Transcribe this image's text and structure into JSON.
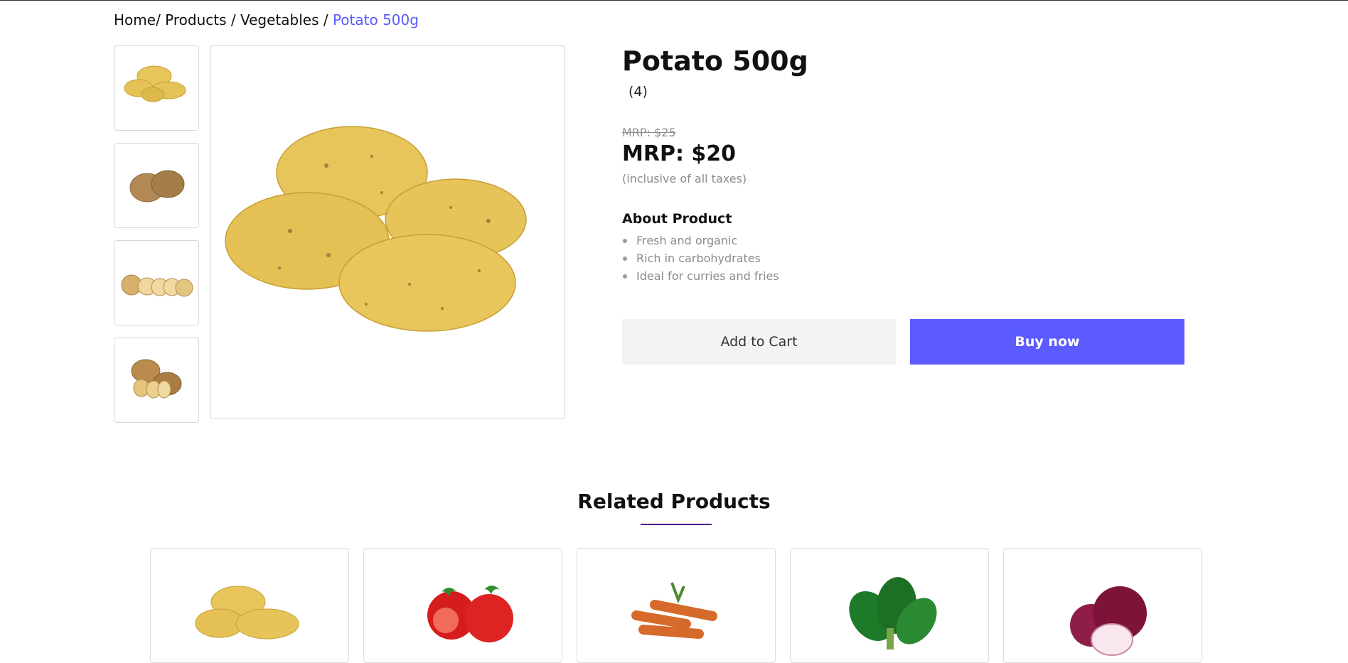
{
  "breadcrumb": {
    "home": "Home",
    "products": "Products",
    "vegetables": "Vegetables",
    "current": "Potato 500g"
  },
  "product": {
    "title": "Potato 500g",
    "rating": "(4)",
    "mrp_old": "MRP: $25",
    "mrp_new": "MRP: $20",
    "tax_note": "(inclusive of all taxes)",
    "about_title": "About Product",
    "about_points": [
      "Fresh and organic",
      "Rich in carbohydrates",
      "Ideal for curries and fries"
    ]
  },
  "buttons": {
    "add_to_cart": "Add to Cart",
    "buy_now": "Buy now"
  },
  "related": {
    "title": "Related Products",
    "items": [
      "potato",
      "tomato",
      "carrot",
      "spinach",
      "onion"
    ]
  },
  "colors": {
    "accent": "#5b5bff",
    "underline": "#4b0f88",
    "muted": "#8b8b8b",
    "cart_bg": "#f2f3f5"
  }
}
